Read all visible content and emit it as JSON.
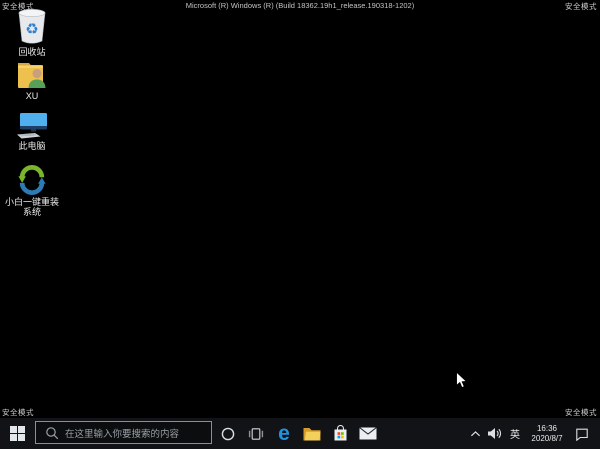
{
  "desktop": {
    "safe_mode_label": "安全模式",
    "build_text": "Microsoft (R) Windows (R) (Build 18362.19h1_release.190318-1202)",
    "recycle_glyph": "♻",
    "icons": [
      {
        "name": "recycle-bin",
        "label": "回收站"
      },
      {
        "name": "user-folder",
        "label": "XU"
      },
      {
        "name": "this-pc",
        "label": "此电脑"
      },
      {
        "name": "xiaobai-reinstall",
        "label": "小白一键重装系统"
      }
    ]
  },
  "taskbar": {
    "search_placeholder": "在这里输入你要搜索的内容",
    "edge_glyph": "e",
    "buttons": [
      "start",
      "search",
      "cortana",
      "task-view",
      "edge",
      "file-explorer",
      "store",
      "mail"
    ],
    "tray": {
      "hidden_icons": "chevron-up",
      "volume": "speaker",
      "input_method": "英",
      "time": "16:36",
      "date": "2020/8/7",
      "action_center": "notification"
    }
  },
  "colors": {
    "desktop_bg": "#000000",
    "taskbar_bg": "#121316",
    "edge_blue": "#1e93e6",
    "folder_yellow": "#f5cf5c",
    "store_red": "#f25022",
    "store_green": "#7fba00",
    "store_blue": "#00a4ef",
    "store_yellow": "#ffb900",
    "recycle_blue": "#2f7fd0",
    "xiaobai_green": "#7ab62c",
    "xiaobai_blue": "#2c7ab6"
  }
}
